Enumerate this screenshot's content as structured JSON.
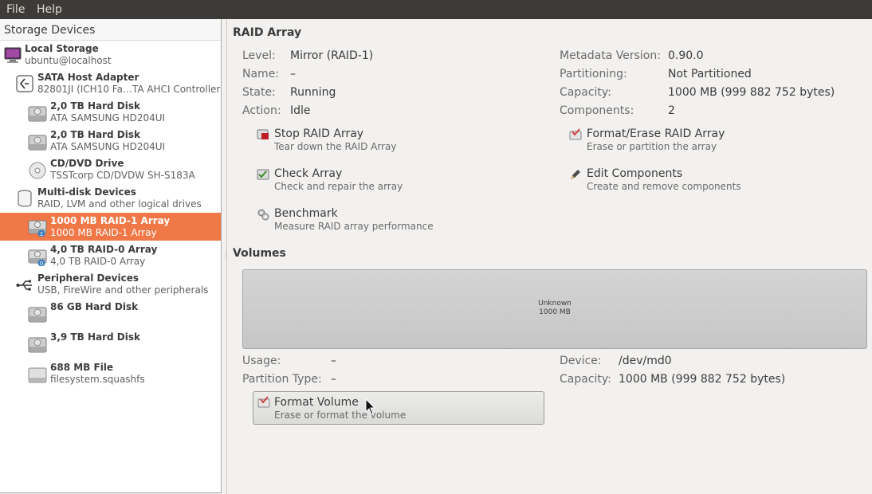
{
  "menubar": {
    "file": "File",
    "help": "Help"
  },
  "sidebar": {
    "header": "Storage Devices",
    "items": [
      {
        "title": "Local Storage",
        "subtitle": "ubuntu@localhost",
        "icon": "computer-icon"
      },
      {
        "title": "SATA Host Adapter",
        "subtitle": "82801JI (ICH10 Fa…TA AHCI Controller",
        "icon": "adapter-icon"
      },
      {
        "title": "2,0 TB Hard Disk",
        "subtitle": "ATA SAMSUNG HD204UI",
        "icon": "hard-disk-icon"
      },
      {
        "title": "2,0 TB Hard Disk",
        "subtitle": "ATA SAMSUNG HD204UI",
        "icon": "hard-disk-icon"
      },
      {
        "title": "CD/DVD Drive",
        "subtitle": "TSSTcorp CD/DVDW SH-S183A",
        "icon": "optical-disc-icon"
      },
      {
        "title": "Multi-disk Devices",
        "subtitle": "RAID, LVM and other logical drives",
        "icon": "multidisk-icon"
      },
      {
        "title": "1000 MB RAID-1 Array",
        "subtitle": "1000 MB RAID-1 Array",
        "icon": "raid-icon",
        "badge": "1",
        "selected": true
      },
      {
        "title": "4,0 TB RAID-0 Array",
        "subtitle": "4,0 TB RAID-0 Array",
        "icon": "raid-icon",
        "badge": "0"
      },
      {
        "title": "Peripheral Devices",
        "subtitle": "USB, FireWire and other peripherals",
        "icon": "usb-icon"
      },
      {
        "title": "86 GB Hard Disk",
        "subtitle": "",
        "icon": "hard-disk-icon"
      },
      {
        "title": "3,9 TB Hard Disk",
        "subtitle": "",
        "icon": "hard-disk-icon"
      },
      {
        "title": "688 MB File",
        "subtitle": "filesystem.squashfs",
        "icon": "file-disk-icon"
      }
    ]
  },
  "raid": {
    "title": "RAID Array",
    "left": [
      {
        "label": "Level:",
        "value": "Mirror (RAID-1)"
      },
      {
        "label": "Name:",
        "value": "–"
      },
      {
        "label": "State:",
        "value": "Running"
      },
      {
        "label": "Action:",
        "value": "Idle"
      }
    ],
    "right": [
      {
        "label": "Metadata Version:",
        "value": "0.90.0"
      },
      {
        "label": "Partitioning:",
        "value": "Not Partitioned"
      },
      {
        "label": "Capacity:",
        "value": "1000 MB (999 882 752 bytes)"
      },
      {
        "label": "Components:",
        "value": "2"
      }
    ],
    "actions": [
      {
        "title": "Stop RAID Array",
        "desc": "Tear down the RAID Array",
        "icon": "stop-icon"
      },
      {
        "title": "Format/Erase RAID Array",
        "desc": "Erase or partition the array",
        "icon": "format-icon"
      },
      {
        "title": "Check Array",
        "desc": "Check and repair the array",
        "icon": "check-icon"
      },
      {
        "title": "Edit Components",
        "desc": "Create and remove components",
        "icon": "pencil-icon"
      },
      {
        "title": "Benchmark",
        "desc": "Measure RAID array performance",
        "icon": "benchmark-icon"
      }
    ]
  },
  "volumes": {
    "title": "Volumes",
    "bar_line1": "Unknown",
    "bar_line2": "1000 MB",
    "left": [
      {
        "label": "Usage:",
        "value": "–"
      },
      {
        "label": "Partition Type:",
        "value": "–"
      }
    ],
    "right": [
      {
        "label": "Device:",
        "value": "/dev/md0"
      },
      {
        "label": "Capacity:",
        "value": "1000 MB (999 882 752 bytes)"
      }
    ],
    "format_button": {
      "title": "Format Volume",
      "desc": "Erase or format the volume"
    }
  },
  "colors": {
    "selection": "#f07746",
    "menubar": "#3c3b37",
    "stop_red": "#c01c28"
  }
}
